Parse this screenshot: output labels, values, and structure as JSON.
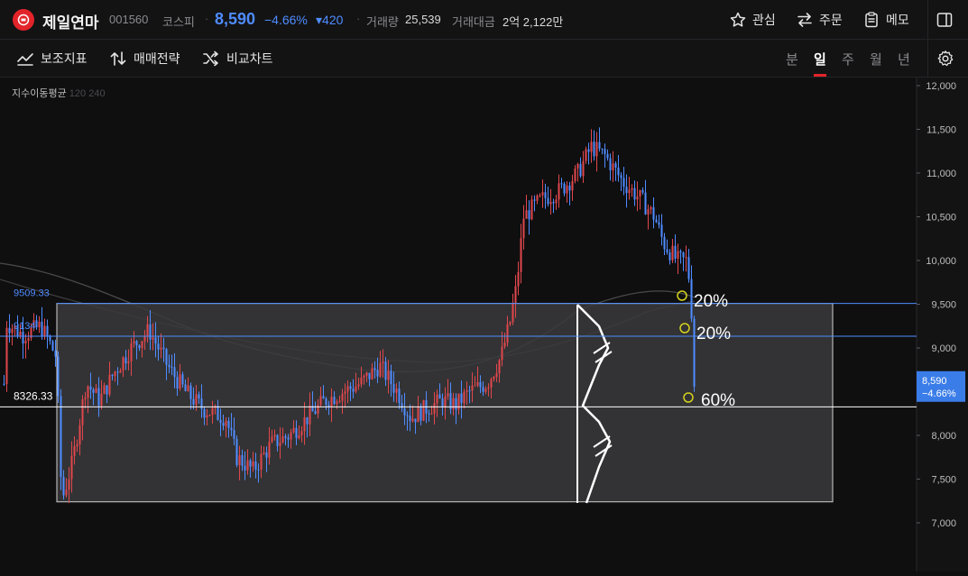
{
  "header": {
    "stock_name": "제일연마",
    "stock_code": "001560",
    "market": "코스피",
    "price": "8,590",
    "change_pct": "−4.66%",
    "change_amount": "▾420",
    "volume_label": "거래량",
    "volume_value": "25,539",
    "amount_label": "거래대금",
    "amount_value": "2억 2,122만",
    "actions": {
      "watch": "관심",
      "order": "주문",
      "memo": "메모"
    }
  },
  "toolbar": {
    "indicator": "보조지표",
    "strategy": "매매전략",
    "compare": "비교차트",
    "periods": [
      "분",
      "일",
      "주",
      "월",
      "년"
    ],
    "active_period": "일"
  },
  "chart": {
    "ma_label": "지수이동평균",
    "ma_periods": "120 240",
    "y_axis_ticks": [
      "12,000",
      "11,500",
      "11,000",
      "10,500",
      "10,000",
      "9,500",
      "9,000",
      "8,500",
      "8,000",
      "7,500",
      "7,000"
    ],
    "y_tick_values": [
      12000,
      11500,
      11000,
      10500,
      10000,
      9500,
      9000,
      8500,
      8000,
      7500,
      7000
    ],
    "price_tag": {
      "price": "8,590",
      "change": "−4.66%"
    },
    "hlines": [
      {
        "label": "9509.33",
        "value": 9509.33
      },
      {
        "label": "9134",
        "value": 9134
      },
      {
        "label": "8326.33",
        "value": 8326.33
      }
    ],
    "annotations": [
      "20%",
      "20%",
      "60%"
    ],
    "colors": {
      "up": "#e0474c",
      "down": "#4f8cff",
      "accent": "#4f8cff",
      "marker": "#d6d21e"
    }
  }
}
